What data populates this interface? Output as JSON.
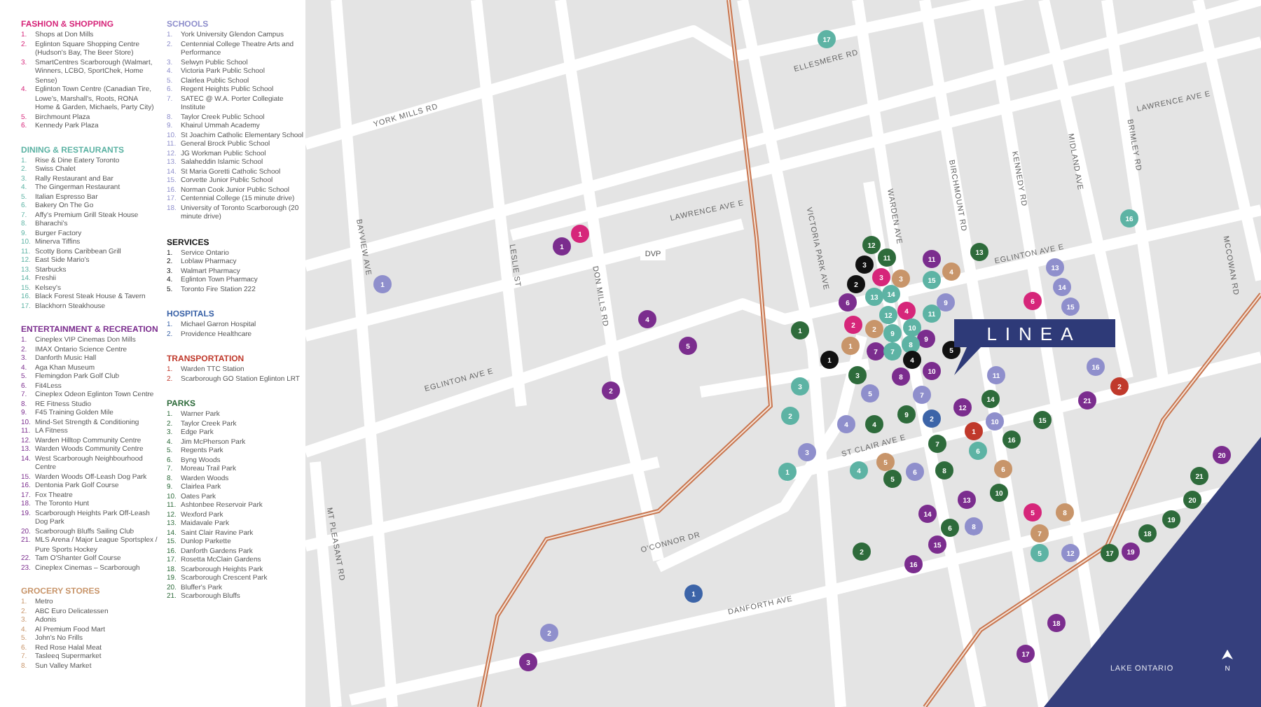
{
  "legend": {
    "columns": [
      [
        {
          "title": "FASHION & SHOPPING",
          "color": "#d6267a",
          "kind": "fashion",
          "items": [
            {
              "number": "1.",
              "name": "Shops at Don Mills"
            },
            {
              "number": "2.",
              "name": "Eglinton Square Shopping Centre (Hudson's Bay, The Beer Store)"
            },
            {
              "number": "3.",
              "name": "SmartCentres Scarborough (Walmart, Winners, LCBO, SportChek, Home Sense)"
            },
            {
              "number": "4.",
              "name": "Eglinton Town Centre (Canadian Tire, Lowe's, Marshall's, Roots, RONA Home & Garden, Michaels, Party City)"
            },
            {
              "number": "5.",
              "name": "Birchmount Plaza"
            },
            {
              "number": "6.",
              "name": "Kennedy Park Plaza"
            }
          ]
        },
        {
          "title": "DINING & RESTAURANTS",
          "color": "#5db3a4",
          "kind": "dining",
          "items": [
            {
              "number": "1.",
              "name": "Rise & Dine Eatery Toronto"
            },
            {
              "number": "2.",
              "name": "Swiss Chalet"
            },
            {
              "number": "3.",
              "name": "Rally Restaurant and Bar"
            },
            {
              "number": "4.",
              "name": "The Gingerman Restaurant"
            },
            {
              "number": "5.",
              "name": "Italian Espresso Bar"
            },
            {
              "number": "6.",
              "name": "Bakery On The Go"
            },
            {
              "number": "7.",
              "name": "Affy's Premium Grill Steak House"
            },
            {
              "number": "8.",
              "name": "Bharachi's"
            },
            {
              "number": "9.",
              "name": "Burger Factory"
            },
            {
              "number": "10.",
              "name": "Minerva Tiffins"
            },
            {
              "number": "11.",
              "name": "Scotty Bons Caribbean Grill"
            },
            {
              "number": "12.",
              "name": "East Side Mario's"
            },
            {
              "number": "13.",
              "name": "Starbucks"
            },
            {
              "number": "14.",
              "name": "Freshii"
            },
            {
              "number": "15.",
              "name": "Kelsey's"
            },
            {
              "number": "16.",
              "name": "Black Forest Steak House & Tavern"
            },
            {
              "number": "17.",
              "name": "Blackhorn Steakhouse"
            }
          ]
        },
        {
          "title": "ENTERTAINMENT & RECREATION",
          "color": "#7b2d8e",
          "kind": "entertainment",
          "items": [
            {
              "number": "1.",
              "name": "Cineplex VIP Cinemas Don Mills"
            },
            {
              "number": "2.",
              "name": "IMAX Ontario Science Centre"
            },
            {
              "number": "3.",
              "name": "Danforth Music Hall"
            },
            {
              "number": "4.",
              "name": "Aga Khan Museum"
            },
            {
              "number": "5.",
              "name": "Flemingdon Park Golf Club"
            },
            {
              "number": "6.",
              "name": "Fit4Less"
            },
            {
              "number": "7.",
              "name": "Cineplex Odeon Eglinton Town Centre"
            },
            {
              "number": "8.",
              "name": "RE Fitness Studio"
            },
            {
              "number": "9.",
              "name": "F45 Training Golden Mile"
            },
            {
              "number": "10.",
              "name": "Mind-Set Strength & Conditioning"
            },
            {
              "number": "11.",
              "name": "LA Fitness"
            },
            {
              "number": "12.",
              "name": "Warden Hilltop Community Centre"
            },
            {
              "number": "13.",
              "name": "Warden Woods Community Centre"
            },
            {
              "number": "14.",
              "name": "West Scarborough Neighbourhood Centre"
            },
            {
              "number": "15.",
              "name": "Warden Woods Off-Leash Dog Park"
            },
            {
              "number": "16.",
              "name": "Dentonia Park Golf Course"
            },
            {
              "number": "17.",
              "name": "Fox Theatre"
            },
            {
              "number": "18.",
              "name": "The Toronto Hunt"
            },
            {
              "number": "19.",
              "name": "Scarborough Heights Park Off-Leash Dog Park"
            },
            {
              "number": "20.",
              "name": "Scarborough Bluffs Sailing Club"
            },
            {
              "number": "21.",
              "name": "MLS Arena / Major League Sportsplex / Pure Sports Hockey"
            },
            {
              "number": "22.",
              "name": "Tam O'Shanter Golf Course"
            },
            {
              "number": "23.",
              "name": "Cineplex Cinemas – Scarborough"
            }
          ]
        },
        {
          "title": "GROCERY STORES",
          "color": "#c8956a",
          "kind": "grocery",
          "items": [
            {
              "number": "1.",
              "name": "Metro"
            },
            {
              "number": "2.",
              "name": "ABC Euro Delicatessen"
            },
            {
              "number": "3.",
              "name": "Adonis"
            },
            {
              "number": "4.",
              "name": "Al Premium Food Mart"
            },
            {
              "number": "5.",
              "name": "John's No Frills"
            },
            {
              "number": "6.",
              "name": "Red Rose Halal Meat"
            },
            {
              "number": "7.",
              "name": "Tasleeq Supermarket"
            },
            {
              "number": "8.",
              "name": "Sun Valley Market"
            }
          ]
        }
      ],
      [
        {
          "title": "SCHOOLS",
          "color": "#8f8fcc",
          "kind": "schools",
          "items": [
            {
              "number": "1.",
              "name": "York University Glendon Campus"
            },
            {
              "number": "2.",
              "name": "Centennial College Theatre Arts and Performance"
            },
            {
              "number": "3.",
              "name": "Selwyn Public School"
            },
            {
              "number": "4.",
              "name": "Victoria Park Public School"
            },
            {
              "number": "5.",
              "name": "Clairlea Public School"
            },
            {
              "number": "6.",
              "name": "Regent Heights Public School"
            },
            {
              "number": "7.",
              "name": "SATEC @ W.A. Porter Collegiate Institute"
            },
            {
              "number": "8.",
              "name": "Taylor Creek Public School"
            },
            {
              "number": "9.",
              "name": "Khairul Ummah Academy"
            },
            {
              "number": "10.",
              "name": "St Joachim Catholic Elementary School"
            },
            {
              "number": "11.",
              "name": "General Brock Public School"
            },
            {
              "number": "12.",
              "name": "JG Workman Public School"
            },
            {
              "number": "13.",
              "name": "Salaheddin Islamic School"
            },
            {
              "number": "14.",
              "name": "St Maria Goretti Catholic School"
            },
            {
              "number": "15.",
              "name": "Corvette Junior Public School"
            },
            {
              "number": "16.",
              "name": "Norman Cook Junior Public School"
            },
            {
              "number": "17.",
              "name": "Centennial College (15 minute drive)"
            },
            {
              "number": "18.",
              "name": "University of Toronto Scarborough (20 minute drive)"
            }
          ]
        },
        {
          "title": "SERVICES",
          "color": "#111111",
          "kind": "services",
          "items": [
            {
              "number": "1.",
              "name": "Service Ontario"
            },
            {
              "number": "2.",
              "name": "Loblaw Pharmacy"
            },
            {
              "number": "3.",
              "name": "Walmart Pharmacy"
            },
            {
              "number": "4.",
              "name": "Eglinton Town Pharmacy"
            },
            {
              "number": "5.",
              "name": "Toronto Fire Station 222"
            }
          ]
        },
        {
          "title": "HOSPITALS",
          "color": "#3c64a8",
          "kind": "hospitals",
          "items": [
            {
              "number": "1.",
              "name": "Michael Garron Hospital"
            },
            {
              "number": "2.",
              "name": "Providence Healthcare"
            }
          ]
        },
        {
          "title": "TRANSPORTATION",
          "color": "#c0392b",
          "kind": "transportation",
          "items": [
            {
              "number": "1.",
              "name": "Warden TTC Station"
            },
            {
              "number": "2.",
              "name": "Scarborough GO Station Eglinton LRT"
            }
          ]
        },
        {
          "title": "PARKS",
          "color": "#2e6b3b",
          "kind": "parks",
          "items": [
            {
              "number": "1.",
              "name": "Warner Park"
            },
            {
              "number": "2.",
              "name": "Taylor Creek Park"
            },
            {
              "number": "3.",
              "name": "Edge Park"
            },
            {
              "number": "4.",
              "name": "Jim McPherson Park"
            },
            {
              "number": "5.",
              "name": "Regents Park"
            },
            {
              "number": "6.",
              "name": "Byng Woods"
            },
            {
              "number": "7.",
              "name": "Moreau Trail Park"
            },
            {
              "number": "8.",
              "name": "Warden Woods"
            },
            {
              "number": "9.",
              "name": "Clairlea Park"
            },
            {
              "number": "10.",
              "name": "Oates Park"
            },
            {
              "number": "11.",
              "name": "Ashtonbee Reservoir Park"
            },
            {
              "number": "12.",
              "name": "Wexford Park"
            },
            {
              "number": "13.",
              "name": "Maidavale Park"
            },
            {
              "number": "14.",
              "name": "Saint Clair Ravine Park"
            },
            {
              "number": "15.",
              "name": "Dunlop Parkette"
            },
            {
              "number": "16.",
              "name": "Danforth Gardens Park"
            },
            {
              "number": "17.",
              "name": "Rosetta McClain Gardens"
            },
            {
              "number": "18.",
              "name": "Scarborough Heights Park"
            },
            {
              "number": "19.",
              "name": "Scarborough Crescent Park"
            },
            {
              "number": "20.",
              "name": "Bluffer's Park"
            },
            {
              "number": "21.",
              "name": "Scarborough Bluffs"
            }
          ]
        }
      ]
    ]
  },
  "map": {
    "road_labels": [
      {
        "kind": "road",
        "text": "ELLESMERE RD"
      },
      {
        "kind": "road",
        "text": "YORK MILLS RD"
      },
      {
        "kind": "road",
        "text": "LAWRENCE AVE E"
      },
      {
        "kind": "road",
        "text": "LAWRENCE AVE E"
      },
      {
        "kind": "road",
        "text": "BAYVIEW AVE"
      },
      {
        "kind": "road",
        "text": "LESLIE ST"
      },
      {
        "kind": "road",
        "text": "DON MILLS RD"
      },
      {
        "kind": "highway",
        "text": "DVP"
      },
      {
        "kind": "road",
        "text": "VICTORIA PARK AVE"
      },
      {
        "kind": "road",
        "text": "WARDEN AVE"
      },
      {
        "kind": "road",
        "text": "BIRCHMOUNT RD"
      },
      {
        "kind": "road",
        "text": "KENNEDY RD"
      },
      {
        "kind": "road",
        "text": "MIDLAND AVE"
      },
      {
        "kind": "road",
        "text": "BRIMLEY RD"
      },
      {
        "kind": "road",
        "text": "MCCOWAN RD"
      },
      {
        "kind": "road",
        "text": "EGLINTON AVE E"
      },
      {
        "kind": "road",
        "text": "EGLINTON AVE E"
      },
      {
        "kind": "road",
        "text": "ST CLAIR AVE E"
      },
      {
        "kind": "road",
        "text": "O'CONNOR DR"
      },
      {
        "kind": "road",
        "text": "DANFORTH AVE"
      },
      {
        "kind": "road",
        "text": "MT PLEASANT RD"
      }
    ],
    "callout": "LINEA",
    "water_label": "LAKE ONTARIO",
    "north_label": "N",
    "markers": [
      {
        "kind": "dining",
        "label": "17"
      },
      {
        "kind": "dining",
        "label": "16"
      },
      {
        "kind": "fashion",
        "label": "1"
      },
      {
        "kind": "entertainment",
        "label": "1"
      },
      {
        "kind": "parks",
        "label": "12"
      },
      {
        "kind": "parks",
        "label": "13"
      },
      {
        "kind": "parks",
        "label": "11"
      },
      {
        "kind": "entertainment",
        "label": "11"
      },
      {
        "kind": "services",
        "label": "3"
      },
      {
        "kind": "schools",
        "label": "13"
      },
      {
        "kind": "grocery",
        "label": "4"
      },
      {
        "kind": "fashion",
        "label": "3"
      },
      {
        "kind": "grocery",
        "label": "3"
      },
      {
        "kind": "dining",
        "label": "15"
      },
      {
        "kind": "schools",
        "label": "1"
      },
      {
        "kind": "services",
        "label": "2"
      },
      {
        "kind": "schools",
        "label": "14"
      },
      {
        "kind": "dining",
        "label": "13"
      },
      {
        "kind": "dining",
        "label": "14"
      },
      {
        "kind": "entertainment",
        "label": "6"
      },
      {
        "kind": "schools",
        "label": "9"
      },
      {
        "kind": "fashion",
        "label": "6"
      },
      {
        "kind": "schools",
        "label": "15"
      },
      {
        "kind": "fashion",
        "label": "4"
      },
      {
        "kind": "dining",
        "label": "12"
      },
      {
        "kind": "dining",
        "label": "11"
      },
      {
        "kind": "entertainment",
        "label": "4"
      },
      {
        "kind": "fashion",
        "label": "2"
      },
      {
        "kind": "parks",
        "label": "1"
      },
      {
        "kind": "grocery",
        "label": "2"
      },
      {
        "kind": "dining",
        "label": "10"
      },
      {
        "kind": "dining",
        "label": "9"
      },
      {
        "kind": "entertainment",
        "label": "9"
      },
      {
        "kind": "entertainment",
        "label": "5"
      },
      {
        "kind": "grocery",
        "label": "1"
      },
      {
        "kind": "dining",
        "label": "8"
      },
      {
        "kind": "entertainment",
        "label": "7"
      },
      {
        "kind": "dining",
        "label": "7"
      },
      {
        "kind": "services",
        "label": "5"
      },
      {
        "kind": "services",
        "label": "1"
      },
      {
        "kind": "services",
        "label": "4"
      },
      {
        "kind": "schools",
        "label": "16"
      },
      {
        "kind": "entertainment",
        "label": "10"
      },
      {
        "kind": "parks",
        "label": "3"
      },
      {
        "kind": "entertainment",
        "label": "8"
      },
      {
        "kind": "schools",
        "label": "11"
      },
      {
        "kind": "dining",
        "label": "3"
      },
      {
        "kind": "transportation",
        "label": "2"
      },
      {
        "kind": "entertainment",
        "label": "2"
      },
      {
        "kind": "schools",
        "label": "5"
      },
      {
        "kind": "schools",
        "label": "7"
      },
      {
        "kind": "parks",
        "label": "14"
      },
      {
        "kind": "entertainment",
        "label": "21"
      },
      {
        "kind": "entertainment",
        "label": "12"
      },
      {
        "kind": "dining",
        "label": "2"
      },
      {
        "kind": "parks",
        "label": "9"
      },
      {
        "kind": "hospitals",
        "label": "2"
      },
      {
        "kind": "schools",
        "label": "4"
      },
      {
        "kind": "parks",
        "label": "4"
      },
      {
        "kind": "schools",
        "label": "10"
      },
      {
        "kind": "parks",
        "label": "15"
      },
      {
        "kind": "transportation",
        "label": "1"
      },
      {
        "kind": "parks",
        "label": "16"
      },
      {
        "kind": "parks",
        "label": "7"
      },
      {
        "kind": "schools",
        "label": "3"
      },
      {
        "kind": "dining",
        "label": "6"
      },
      {
        "kind": "entertainment",
        "label": "20"
      },
      {
        "kind": "grocery",
        "label": "5"
      },
      {
        "kind": "dining",
        "label": "1"
      },
      {
        "kind": "dining",
        "label": "4"
      },
      {
        "kind": "schools",
        "label": "6"
      },
      {
        "kind": "parks",
        "label": "8"
      },
      {
        "kind": "grocery",
        "label": "6"
      },
      {
        "kind": "parks",
        "label": "5"
      },
      {
        "kind": "parks",
        "label": "21"
      },
      {
        "kind": "parks",
        "label": "10"
      },
      {
        "kind": "entertainment",
        "label": "13"
      },
      {
        "kind": "parks",
        "label": "20"
      },
      {
        "kind": "entertainment",
        "label": "14"
      },
      {
        "kind": "fashion",
        "label": "5"
      },
      {
        "kind": "grocery",
        "label": "8"
      },
      {
        "kind": "parks",
        "label": "19"
      },
      {
        "kind": "parks",
        "label": "6"
      },
      {
        "kind": "schools",
        "label": "8"
      },
      {
        "kind": "grocery",
        "label": "7"
      },
      {
        "kind": "parks",
        "label": "18"
      },
      {
        "kind": "entertainment",
        "label": "15"
      },
      {
        "kind": "parks",
        "label": "2"
      },
      {
        "kind": "dining",
        "label": "5"
      },
      {
        "kind": "schools",
        "label": "12"
      },
      {
        "kind": "parks",
        "label": "17"
      },
      {
        "kind": "entertainment",
        "label": "19"
      },
      {
        "kind": "entertainment",
        "label": "16"
      },
      {
        "kind": "hospitals",
        "label": "1"
      },
      {
        "kind": "entertainment",
        "label": "18"
      },
      {
        "kind": "schools",
        "label": "2"
      },
      {
        "kind": "entertainment",
        "label": "17"
      },
      {
        "kind": "entertainment",
        "label": "3"
      }
    ]
  }
}
